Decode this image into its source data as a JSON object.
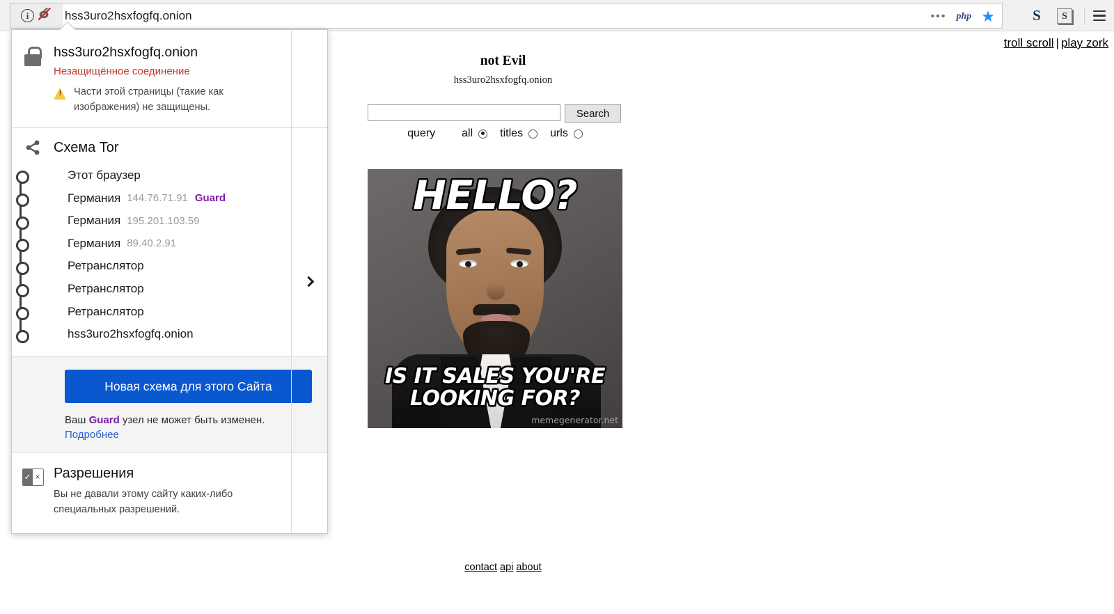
{
  "browser": {
    "url": "hss3uro2hsxfogfq.onion",
    "identity_icon": "info-circle-icon",
    "tor_onion_icon": "broken-onion-icon",
    "urlbar_icons": [
      {
        "name": "more-dots-icon",
        "glyph": "•••"
      },
      {
        "name": "php-extension-icon",
        "label": "php"
      },
      {
        "name": "bookmark-star-icon",
        "glyph": "★"
      }
    ],
    "toolbar_icons": [
      {
        "name": "extension-s-icon",
        "label": "S"
      },
      {
        "name": "extension-s-boxed-icon",
        "label": "S"
      }
    ],
    "menu_icon": "hamburger-menu-icon"
  },
  "popup": {
    "security": {
      "icon": "padlock-icon",
      "host": "hss3uro2hsxfogfq.onion",
      "status": "Незащищённое соединение",
      "warning_icon": "warning-triangle-icon",
      "warning": "Части этой страницы (такие как изображения) не защищены.",
      "expand_icon": "chevron-right-icon"
    },
    "circuit": {
      "icon": "tor-circuit-icon",
      "title": "Схема Tor",
      "nodes": [
        {
          "label": "Этот браузер",
          "ip": "",
          "tag": ""
        },
        {
          "label": "Германия",
          "ip": "144.76.71.91",
          "tag": "Guard"
        },
        {
          "label": "Германия",
          "ip": "195.201.103.59",
          "tag": ""
        },
        {
          "label": "Германия",
          "ip": "89.40.2.91",
          "tag": ""
        },
        {
          "label": "Ретранслятор",
          "ip": "",
          "tag": ""
        },
        {
          "label": "Ретранслятор",
          "ip": "",
          "tag": ""
        },
        {
          "label": "Ретранслятор",
          "ip": "",
          "tag": ""
        },
        {
          "label": "hss3uro2hsxfogfq.onion",
          "ip": "",
          "tag": ""
        }
      ]
    },
    "new_circuit": {
      "button_label": "Новая схема для этого Сайта",
      "note_prefix": "Ваш ",
      "note_tag": "Guard",
      "note_suffix": " узел не может быть изменен.",
      "learn_more": "Подробнее",
      "button_color": "#0a58d0",
      "tag_color": "#7a1fa2"
    },
    "permissions": {
      "icon": "permissions-icon",
      "title": "Разрешения",
      "text": "Вы не давали этому сайту каких-либо специальных разрешений."
    }
  },
  "page": {
    "top_links": [
      {
        "label": "troll scroll"
      },
      {
        "label": "play zork"
      }
    ],
    "top_links_separator": "|",
    "site_title": "not Evil",
    "site_domain": "hss3uro2hsxfogfq.onion",
    "search": {
      "value": "",
      "placeholder": "",
      "button_label": "Search",
      "query_label": "query",
      "options": [
        {
          "label": "all",
          "selected": true
        },
        {
          "label": "titles",
          "selected": false
        },
        {
          "label": "urls",
          "selected": false
        }
      ]
    },
    "meme": {
      "top_text": "HELLO?",
      "bottom_text": "IS IT SALES YOU'RE LOOKING FOR?",
      "watermark": "memegenerator.net"
    },
    "footer_links": [
      {
        "label": "contact"
      },
      {
        "label": "api"
      },
      {
        "label": "about"
      }
    ]
  }
}
